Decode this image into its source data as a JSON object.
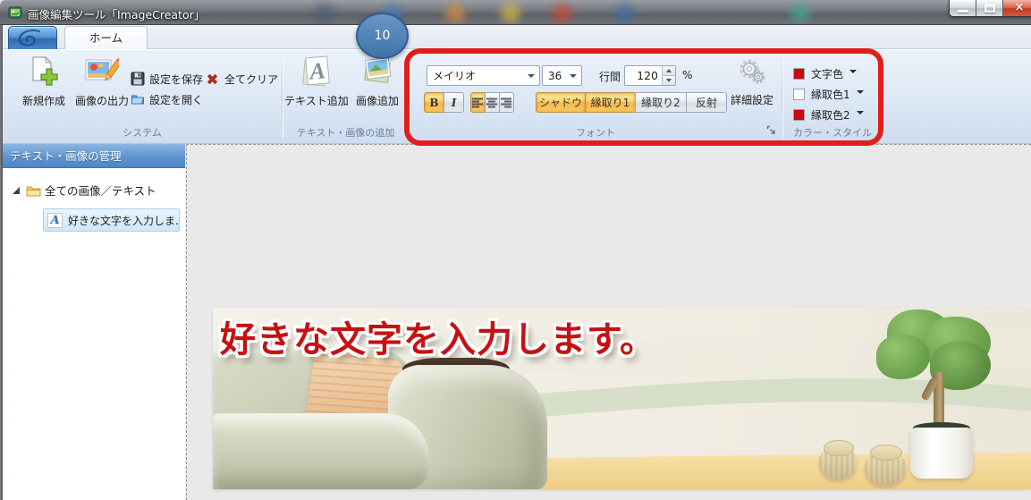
{
  "window": {
    "title": "画像編集ツール「ImageCreator」"
  },
  "tabs": {
    "home": "ホーム"
  },
  "system": {
    "label": "システム",
    "new": "新規作成",
    "output": "画像の出力",
    "save": "設定を保存",
    "open": "設定を開く",
    "clear": "全てクリア"
  },
  "add": {
    "label": "テキスト・画像の追加",
    "text": "テキスト追加",
    "image": "画像追加"
  },
  "font": {
    "label": "フォント",
    "family": "メイリオ",
    "size": "36",
    "line_spacing_label": "行間",
    "line_spacing_value": "120",
    "percent": "%",
    "bold": "B",
    "italic": "I",
    "effects": [
      {
        "label": "シャドウ",
        "active": true
      },
      {
        "label": "縁取り1",
        "active": true
      },
      {
        "label": "縁取り2",
        "active": false
      },
      {
        "label": "反射",
        "active": false
      }
    ],
    "advanced": "詳細設定"
  },
  "colors": {
    "label": "カラー・スタイル",
    "items": [
      {
        "label": "文字色",
        "swatch": "#c60b0e"
      },
      {
        "label": "縁取色1",
        "swatch": "#ffffff"
      },
      {
        "label": "縁取色2",
        "swatch": "#c60b0e"
      }
    ]
  },
  "sidebar": {
    "header": "テキスト・画像の管理",
    "root": "全ての画像／テキスト",
    "item": "好きな文字を入力しま.."
  },
  "canvas": {
    "banner_text": "好きな文字を入力します。"
  },
  "annotations": {
    "badge": "10"
  },
  "icons": {
    "app": "paint-board-icon",
    "new": "new-document-plus-icon",
    "output": "photo-pencil-icon",
    "save": "floppy-disk-icon",
    "open": "open-folder-icon",
    "clear": "red-cross-icon",
    "text_add": "page-letter-a-icon",
    "image_add": "photo-stack-icon",
    "advanced": "gears-icon",
    "launcher": "dialog-launcher-icon",
    "tree_folder": "folder-icon",
    "tree_text": "text-a-icon"
  },
  "theme": {
    "annotation_red": "#e41d1a",
    "badge_blue": "#3f74a8",
    "toggle_orange": "#f9b74b",
    "banner_text_red": "#c61112",
    "ribbon_blue": "#dde8f5"
  }
}
